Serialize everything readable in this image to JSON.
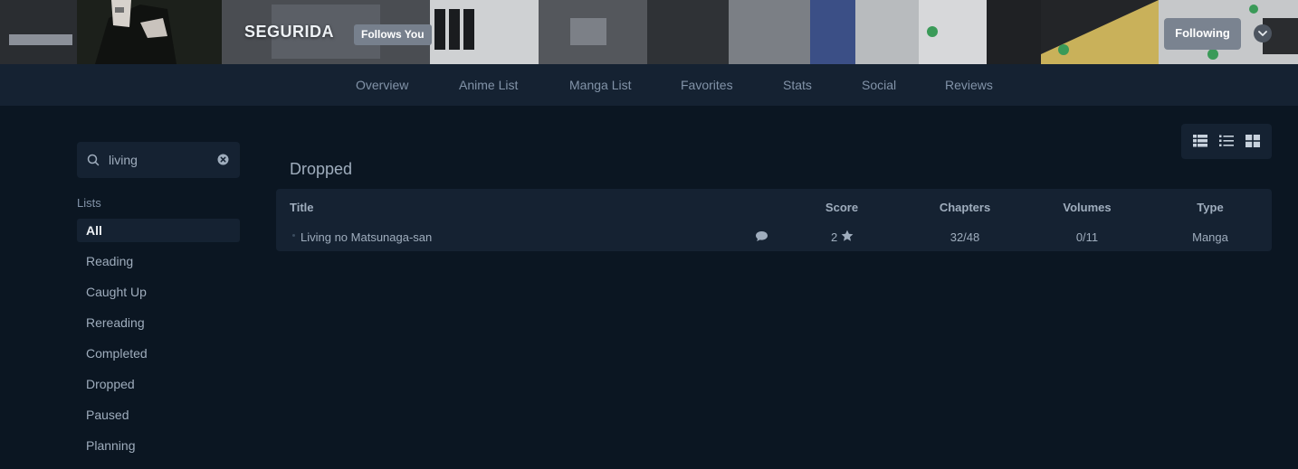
{
  "profile": {
    "username": "SEGURIDA",
    "follows_badge": "Follows You",
    "following_label": "Following"
  },
  "nav": {
    "items": [
      "Overview",
      "Anime List",
      "Manga List",
      "Favorites",
      "Stats",
      "Social",
      "Reviews"
    ]
  },
  "search": {
    "value": "living"
  },
  "sidebar": {
    "lists_heading": "Lists",
    "items": [
      "All",
      "Reading",
      "Caught Up",
      "Rereading",
      "Completed",
      "Dropped",
      "Paused",
      "Planning"
    ],
    "active": "All"
  },
  "main": {
    "section_title": "Dropped",
    "columns": [
      "Title",
      "Score",
      "Chapters",
      "Volumes",
      "Type"
    ],
    "rows": [
      {
        "title": "Living no Matsunaga-san",
        "score": "2",
        "chapters": "32/48",
        "volumes": "0/11",
        "type": "Manga"
      }
    ]
  },
  "icons": {
    "search": "search-icon",
    "clear": "clear-icon",
    "dropdown": "chevron-down-icon",
    "notes": "comment-icon",
    "score": "star-icon",
    "views": [
      "table-view-icon",
      "list-view-icon",
      "grid-view-icon"
    ]
  },
  "colors": {
    "background": "#0b1622",
    "panel": "#152232",
    "text": "#9fadbd",
    "muted": "#8293a8",
    "button": "#7a8390"
  }
}
